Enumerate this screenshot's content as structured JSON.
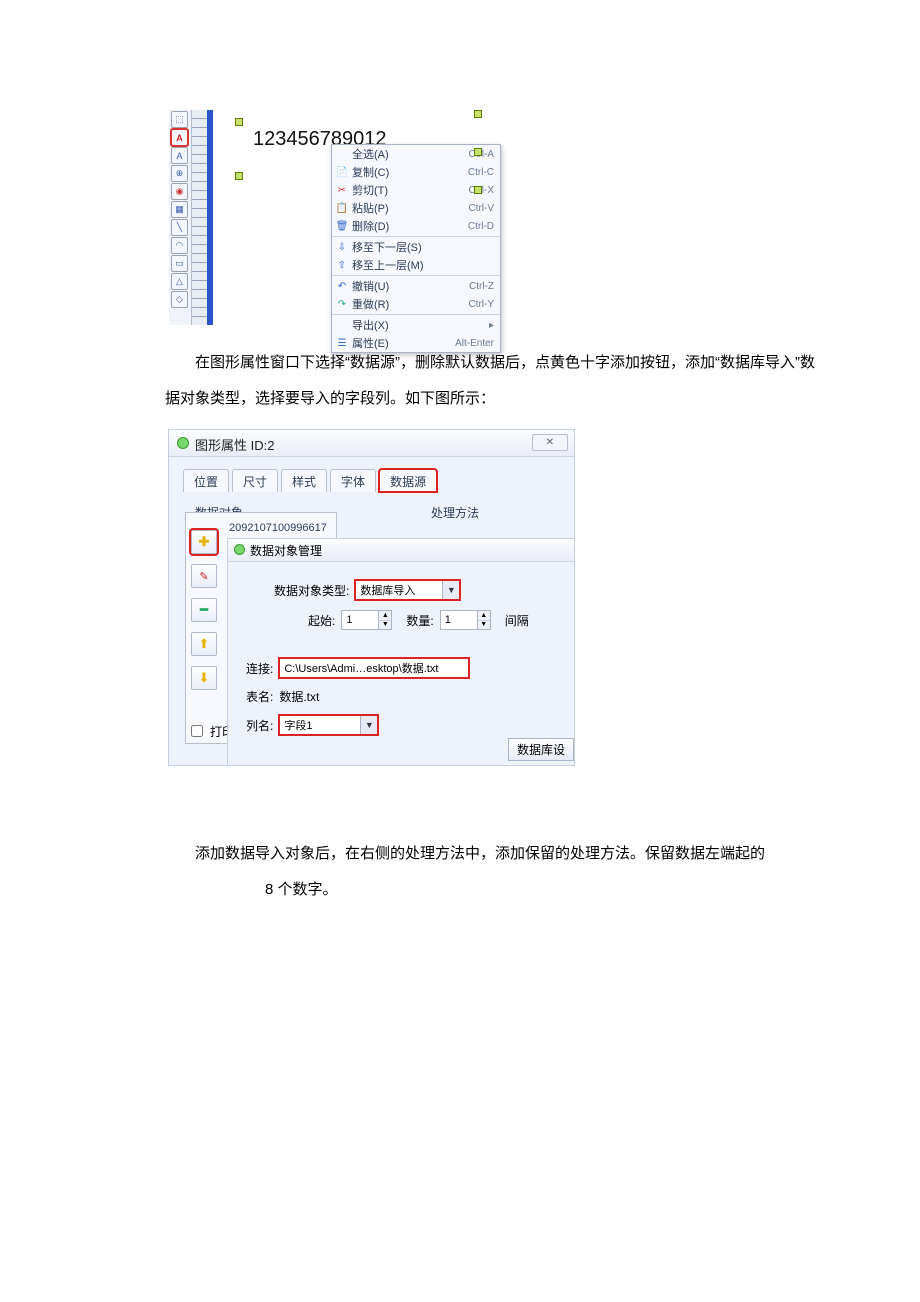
{
  "block1": {
    "number_text": "123456789012",
    "menu": [
      {
        "icon": "",
        "label": "全选(A)",
        "shortcut": "Ctrl-A"
      },
      {
        "icon": "📄",
        "label": "复制(C)",
        "shortcut": "Ctrl-C"
      },
      {
        "icon": "✂",
        "label": "剪切(T)",
        "shortcut": "Ctrl-X"
      },
      {
        "icon": "📋",
        "label": "粘贴(P)",
        "shortcut": "Ctrl-V"
      },
      {
        "icon": "🗑",
        "label": "删除(D)",
        "shortcut": "Ctrl-D"
      },
      {
        "sep": true
      },
      {
        "icon": "⇩",
        "label": "移至下一层(S)",
        "shortcut": ""
      },
      {
        "icon": "⇧",
        "label": "移至上一层(M)",
        "shortcut": ""
      },
      {
        "sep": true
      },
      {
        "icon": "↶",
        "label": "撤销(U)",
        "shortcut": "Ctrl-Z"
      },
      {
        "icon": "↷",
        "label": "重做(R)",
        "shortcut": "Ctrl-Y"
      },
      {
        "sep": true
      },
      {
        "icon": "",
        "label": "导出(X)",
        "shortcut": "▸"
      },
      {
        "icon": "☰",
        "label": "属性(E)",
        "shortcut": "Alt-Enter"
      }
    ]
  },
  "para1": "在图形属性窗口下选择“数据源”，删除默认数据后，点黄色十字添加按钮，添加“数据库导入”数据对象类型，选择要导入的字段列。如下图所示：",
  "block2": {
    "title": "图形属性 ID:2",
    "close": "✕",
    "tabs": [
      "位置",
      "尺寸",
      "样式",
      "字体",
      "数据源"
    ],
    "data_object_label": "数据对象",
    "process_label": "处理方法",
    "number_strip": "2092107100996617",
    "print_label": "打印",
    "sub": {
      "title": "数据对象管理",
      "type_label": "数据对象类型:",
      "type_value": "数据库导入",
      "start_label": "起始:",
      "start_value": "1",
      "count_label": "数量:",
      "count_value": "1",
      "interval_label": "间隔",
      "link_label": "连接:",
      "link_value": "C:\\Users\\Admi…esktop\\数据.txt",
      "table_label": "表名:",
      "table_value": "数据.txt",
      "col_label": "列名:",
      "col_value": "字段1",
      "dbset_label": "数据库设"
    }
  },
  "para2a": "添加数据导入对象后，在右侧的处理方法中，添加保留的处理方法。保留数据左端起的",
  "para2b": "8 个数字。"
}
